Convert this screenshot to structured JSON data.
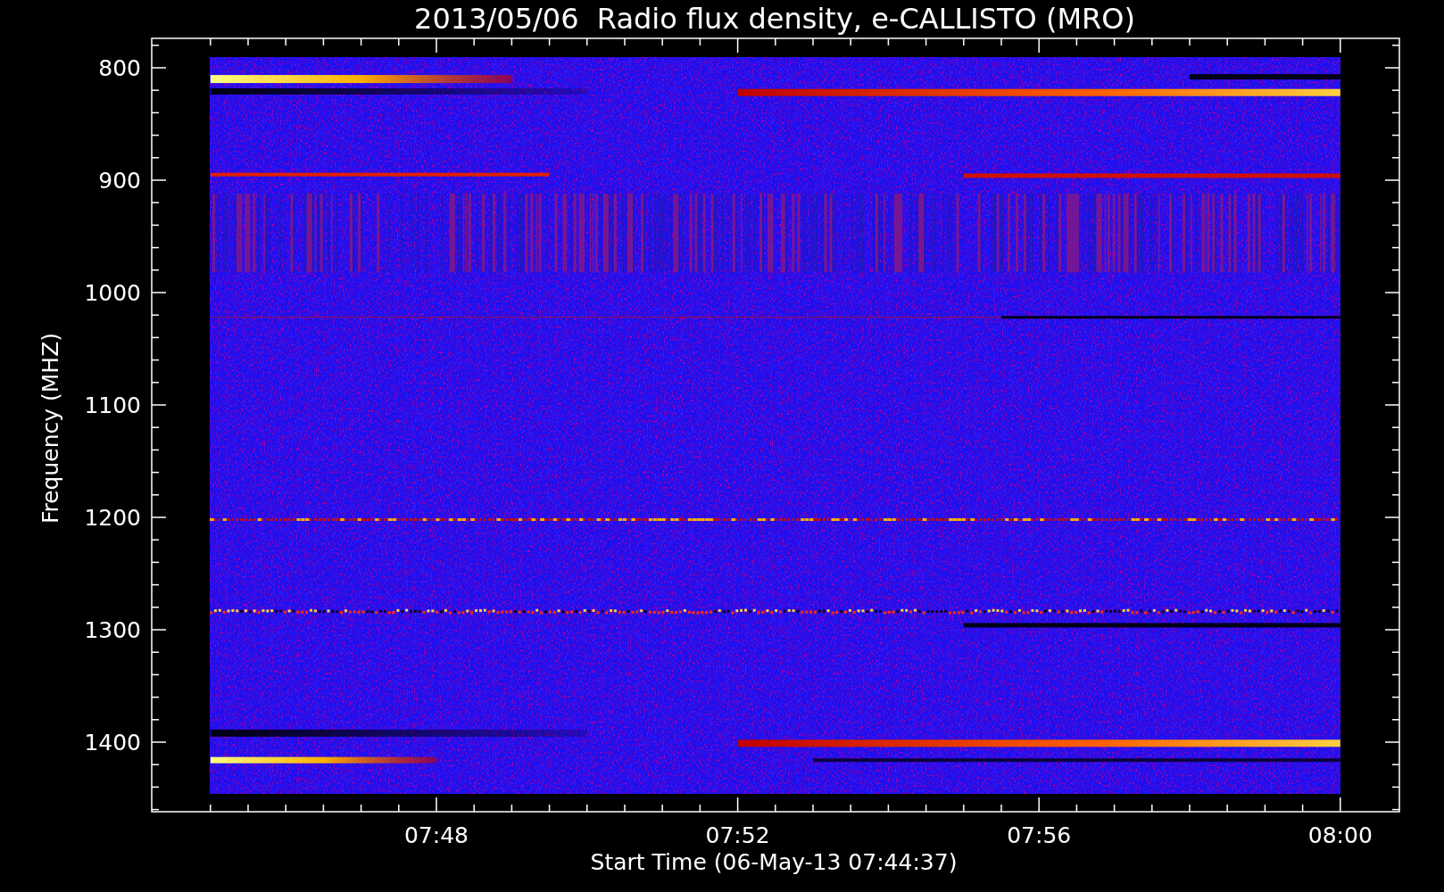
{
  "chart": {
    "title": "2013/05/06  Radio flux density, e-CALLISTO (MRO)",
    "ylabel": "Frequency (MHZ)",
    "xlabel": "Start Time (06-May-13 07:44:37)",
    "yticks": [
      "800",
      "900",
      "1000",
      "1100",
      "1200",
      "1300",
      "1400"
    ],
    "xticks": [
      "07:48",
      "07:52",
      "07:56",
      "08:00"
    ]
  }
}
